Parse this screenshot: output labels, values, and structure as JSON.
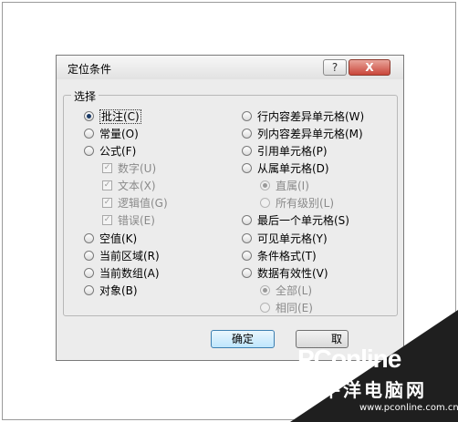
{
  "dialog": {
    "title": "定位条件",
    "help_label": "?",
    "close_label": "X",
    "group_label": "选择",
    "left_options": [
      {
        "label": "批注(C)",
        "checked": true
      },
      {
        "label": "常量(O)",
        "checked": false
      },
      {
        "label": "公式(F)",
        "checked": false
      }
    ],
    "formula_subs": [
      {
        "label": "数字(U)"
      },
      {
        "label": "文本(X)"
      },
      {
        "label": "逻辑值(G)"
      },
      {
        "label": "错误(E)"
      }
    ],
    "left_options2": [
      {
        "label": "空值(K)"
      },
      {
        "label": "当前区域(R)"
      },
      {
        "label": "当前数组(A)"
      },
      {
        "label": "对象(B)"
      }
    ],
    "right_options": [
      {
        "label": "行内容差异单元格(W)"
      },
      {
        "label": "列内容差异单元格(M)"
      },
      {
        "label": "引用单元格(P)"
      },
      {
        "label": "从属单元格(D)"
      }
    ],
    "dependent_subs": [
      {
        "label": "直属(I)",
        "checked": true
      },
      {
        "label": "所有级别(L)",
        "checked": false
      }
    ],
    "right_options2": [
      {
        "label": "最后一个单元格(S)"
      },
      {
        "label": "可见单元格(Y)"
      },
      {
        "label": "条件格式(T)"
      },
      {
        "label": "数据有效性(V)"
      }
    ],
    "validation_subs": [
      {
        "label": "全部(L)",
        "checked": true
      },
      {
        "label": "相同(E)",
        "checked": false
      }
    ],
    "ok_label": "确定",
    "cancel_label": "取"
  },
  "watermark": {
    "logo": "PConline",
    "sub": "太平洋电脑网",
    "url": "www.pconline.com.cn"
  }
}
